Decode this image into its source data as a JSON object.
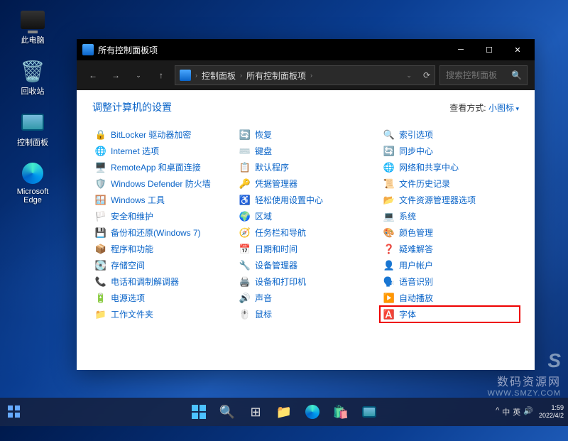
{
  "desktop": {
    "icons": [
      {
        "label": "此电脑",
        "type": "pc"
      },
      {
        "label": "回收站",
        "type": "bin"
      },
      {
        "label": "控制面板",
        "type": "cp"
      },
      {
        "label": "Microsoft Edge",
        "type": "edge"
      }
    ]
  },
  "window": {
    "title": "所有控制面板项",
    "breadcrumb": {
      "root": "控制面板",
      "current": "所有控制面板项"
    },
    "search_placeholder": "搜索控制面板",
    "heading": "调整计算机的设置",
    "viewby_label": "查看方式:",
    "viewby_value": "小图标",
    "items": [
      {
        "icon": "🔒",
        "label": "BitLocker 驱动器加密"
      },
      {
        "icon": "🌐",
        "label": "Internet 选项"
      },
      {
        "icon": "🖥️",
        "label": "RemoteApp 和桌面连接"
      },
      {
        "icon": "🛡️",
        "label": "Windows Defender 防火墙"
      },
      {
        "icon": "🪟",
        "label": "Windows 工具"
      },
      {
        "icon": "🏳️",
        "label": "安全和维护"
      },
      {
        "icon": "💾",
        "label": "备份和还原(Windows 7)"
      },
      {
        "icon": "📦",
        "label": "程序和功能"
      },
      {
        "icon": "💽",
        "label": "存储空间"
      },
      {
        "icon": "📞",
        "label": "电话和调制解调器"
      },
      {
        "icon": "🔋",
        "label": "电源选项"
      },
      {
        "icon": "📁",
        "label": "工作文件夹"
      },
      {
        "icon": "🔄",
        "label": "恢复"
      },
      {
        "icon": "⌨️",
        "label": "键盘"
      },
      {
        "icon": "📋",
        "label": "默认程序"
      },
      {
        "icon": "🔑",
        "label": "凭据管理器"
      },
      {
        "icon": "♿",
        "label": "轻松使用设置中心"
      },
      {
        "icon": "🌍",
        "label": "区域"
      },
      {
        "icon": "🧭",
        "label": "任务栏和导航"
      },
      {
        "icon": "📅",
        "label": "日期和时间"
      },
      {
        "icon": "🔧",
        "label": "设备管理器"
      },
      {
        "icon": "🖨️",
        "label": "设备和打印机"
      },
      {
        "icon": "🔊",
        "label": "声音"
      },
      {
        "icon": "🖱️",
        "label": "鼠标"
      },
      {
        "icon": "🔍",
        "label": "索引选项"
      },
      {
        "icon": "🔄",
        "label": "同步中心"
      },
      {
        "icon": "🌐",
        "label": "网络和共享中心"
      },
      {
        "icon": "📜",
        "label": "文件历史记录"
      },
      {
        "icon": "📂",
        "label": "文件资源管理器选项"
      },
      {
        "icon": "💻",
        "label": "系统"
      },
      {
        "icon": "🎨",
        "label": "颜色管理"
      },
      {
        "icon": "❓",
        "label": "疑难解答"
      },
      {
        "icon": "👤",
        "label": "用户帐户"
      },
      {
        "icon": "🗣️",
        "label": "语音识别"
      },
      {
        "icon": "▶️",
        "label": "自动播放"
      },
      {
        "icon": "🅰️",
        "label": "字体",
        "highlighted": true
      }
    ]
  },
  "taskbar": {
    "time": "1:59",
    "date": "2022/4/2",
    "ime_full": "中",
    "ime_lang": "英",
    "tray_caret": "^"
  },
  "watermark": {
    "logo": "S",
    "main": "数码资源网",
    "sub": "WWW.SMZY.COM"
  }
}
